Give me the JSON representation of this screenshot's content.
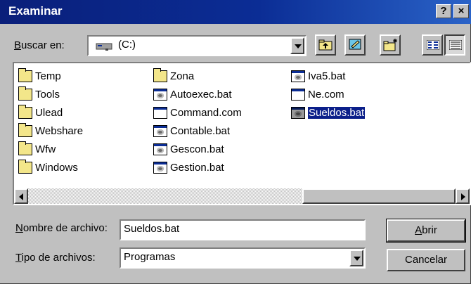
{
  "window": {
    "title": "Examinar",
    "help_label": "?",
    "close_label": "×"
  },
  "lookin": {
    "label_u": "B",
    "label_rest": "uscar en:",
    "value": "(C:)"
  },
  "toolbar": {
    "up_icon": "up-folder-icon",
    "desktop_icon": "desktop-icon",
    "new_folder_icon": "new-folder-icon",
    "list_icon": "list-view-icon",
    "details_icon": "details-view-icon"
  },
  "files": {
    "col1": [
      {
        "name": "Temp",
        "type": "folder"
      },
      {
        "name": "Tools",
        "type": "folder"
      },
      {
        "name": "Ulead",
        "type": "folder"
      },
      {
        "name": "Webshare",
        "type": "folder"
      },
      {
        "name": "Wfw",
        "type": "folder"
      },
      {
        "name": "Windows",
        "type": "folder"
      }
    ],
    "col2": [
      {
        "name": "Zona",
        "type": "folder"
      },
      {
        "name": "Autoexec.bat",
        "type": "bat"
      },
      {
        "name": "Command.com",
        "type": "com"
      },
      {
        "name": "Contable.bat",
        "type": "bat"
      },
      {
        "name": "Gescon.bat",
        "type": "bat"
      },
      {
        "name": "Gestion.bat",
        "type": "bat"
      }
    ],
    "col3": [
      {
        "name": "Iva5.bat",
        "type": "bat"
      },
      {
        "name": "Ne.com",
        "type": "com"
      },
      {
        "name": "Sueldos.bat",
        "type": "bat",
        "selected": true
      }
    ]
  },
  "filename": {
    "label_u": "N",
    "label_rest": "ombre de archivo:",
    "value": "Sueldos.bat"
  },
  "filetype": {
    "label_u": "T",
    "label_rest": "ipo de archivos:",
    "value": "Programas"
  },
  "buttons": {
    "open_u": "A",
    "open_rest": "brir",
    "cancel": "Cancelar"
  }
}
